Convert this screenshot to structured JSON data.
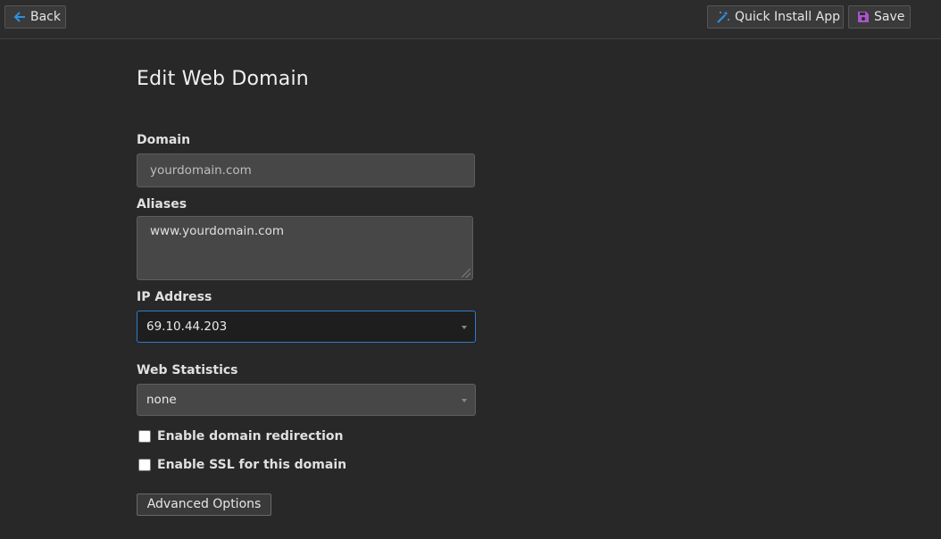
{
  "toolbar": {
    "back_label": "Back",
    "quick_install_label": "Quick Install App",
    "save_label": "Save"
  },
  "page": {
    "title": "Edit Web Domain"
  },
  "form": {
    "domain_label": "Domain",
    "domain_placeholder": "yourdomain.com",
    "aliases_label": "Aliases",
    "aliases_value": "www.yourdomain.com",
    "ip_label": "IP Address",
    "ip_selected": "69.10.44.203",
    "stats_label": "Web Statistics",
    "stats_selected": "none",
    "redirect_label": "Enable domain redirection",
    "ssl_label": "Enable SSL for this domain",
    "advanced_label": "Advanced Options"
  },
  "colors": {
    "accent": "#2f7ad0",
    "save_icon": "#a855c9",
    "back_icon": "#2f8ee0"
  }
}
